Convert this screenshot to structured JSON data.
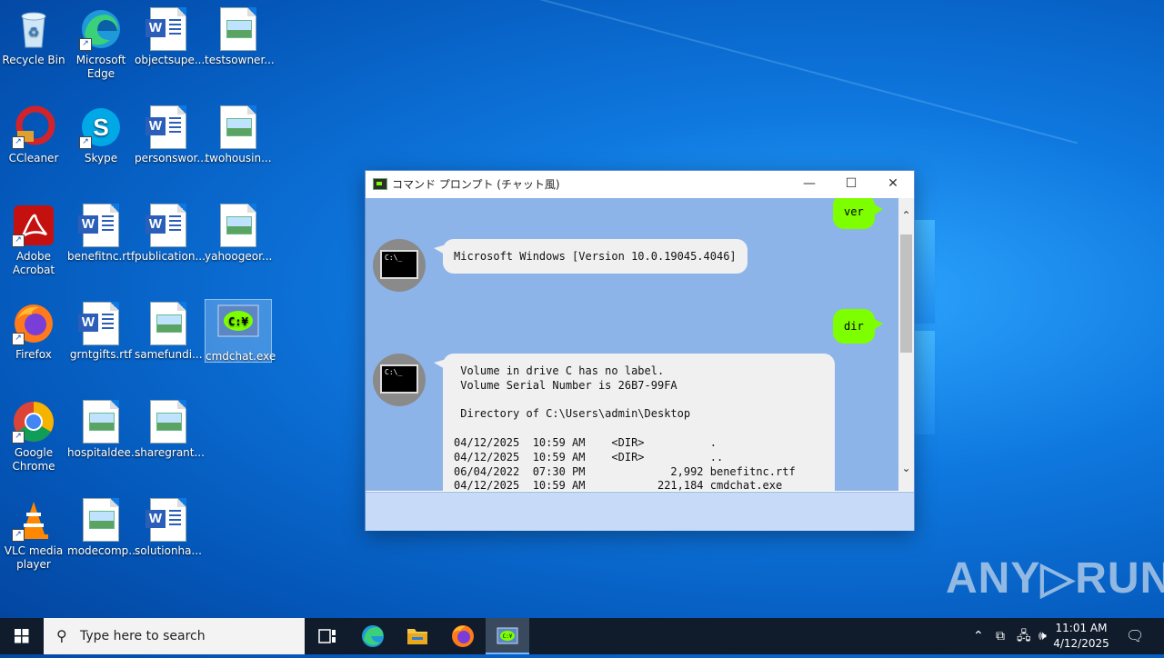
{
  "desktop": {
    "icons": [
      {
        "label": "Recycle Bin",
        "icon": "recycle-bin-icon"
      },
      {
        "label": "Microsoft Edge",
        "icon": "edge-icon"
      },
      {
        "label": "objectsupe...",
        "icon": "word-doc-icon"
      },
      {
        "label": "testsowner...",
        "icon": "image-file-icon"
      },
      {
        "label": "CCleaner",
        "icon": "ccleaner-icon"
      },
      {
        "label": "Skype",
        "icon": "skype-icon"
      },
      {
        "label": "personswor...",
        "icon": "word-doc-icon"
      },
      {
        "label": "twohousin...",
        "icon": "image-file-icon"
      },
      {
        "label": "Adobe Acrobat",
        "icon": "acrobat-icon"
      },
      {
        "label": "benefitnc.rtf",
        "icon": "word-doc-icon"
      },
      {
        "label": "publication...",
        "icon": "word-doc-icon"
      },
      {
        "label": "yahoogeor...",
        "icon": "image-file-icon"
      },
      {
        "label": "Firefox",
        "icon": "firefox-icon"
      },
      {
        "label": "grntgifts.rtf",
        "icon": "word-doc-icon"
      },
      {
        "label": "samefundi...",
        "icon": "image-file-icon"
      },
      {
        "label": "cmdchat.exe",
        "icon": "cmdchat-exe-icon"
      },
      {
        "label": "Google Chrome",
        "icon": "chrome-icon"
      },
      {
        "label": "hospitaldee...",
        "icon": "image-file-icon"
      },
      {
        "label": "sharegrant...",
        "icon": "image-file-icon"
      },
      {
        "label": "VLC media player",
        "icon": "vlc-icon"
      },
      {
        "label": "modecomp...",
        "icon": "image-file-icon"
      },
      {
        "label": "solutionha...",
        "icon": "word-doc-icon"
      }
    ]
  },
  "window": {
    "title": "コマンド プロンプト (チャット風)",
    "minimize": "—",
    "maximize": "☐",
    "close": "✕",
    "messages": [
      {
        "from": "user",
        "text": "ver"
      },
      {
        "from": "bot",
        "text": "Microsoft Windows [Version 10.0.19045.4046]"
      },
      {
        "from": "user",
        "text": "dir"
      },
      {
        "from": "bot",
        "text": " Volume in drive C has no label.\n Volume Serial Number is 26B7-99FA\n\n Directory of C:\\Users\\admin\\Desktop\n\n04/12/2025  10:59 AM    <DIR>          .\n04/12/2025  10:59 AM    <DIR>          ..\n06/04/2022  07:30 PM             2,992 benefitnc.rtf\n04/12/2025  10:59 AM           221,184 cmdchat.exe"
      }
    ],
    "avatar_text": "C:\\_",
    "input_value": ""
  },
  "taskbar": {
    "search_placeholder": "Type here to search",
    "apps": [
      "task-view-icon",
      "edge-icon",
      "file-explorer-icon",
      "firefox-icon",
      "cmdchat-icon"
    ],
    "clock_time": "11:01 AM",
    "clock_date": "4/12/2025"
  },
  "watermark": "ANY▷RUN"
}
